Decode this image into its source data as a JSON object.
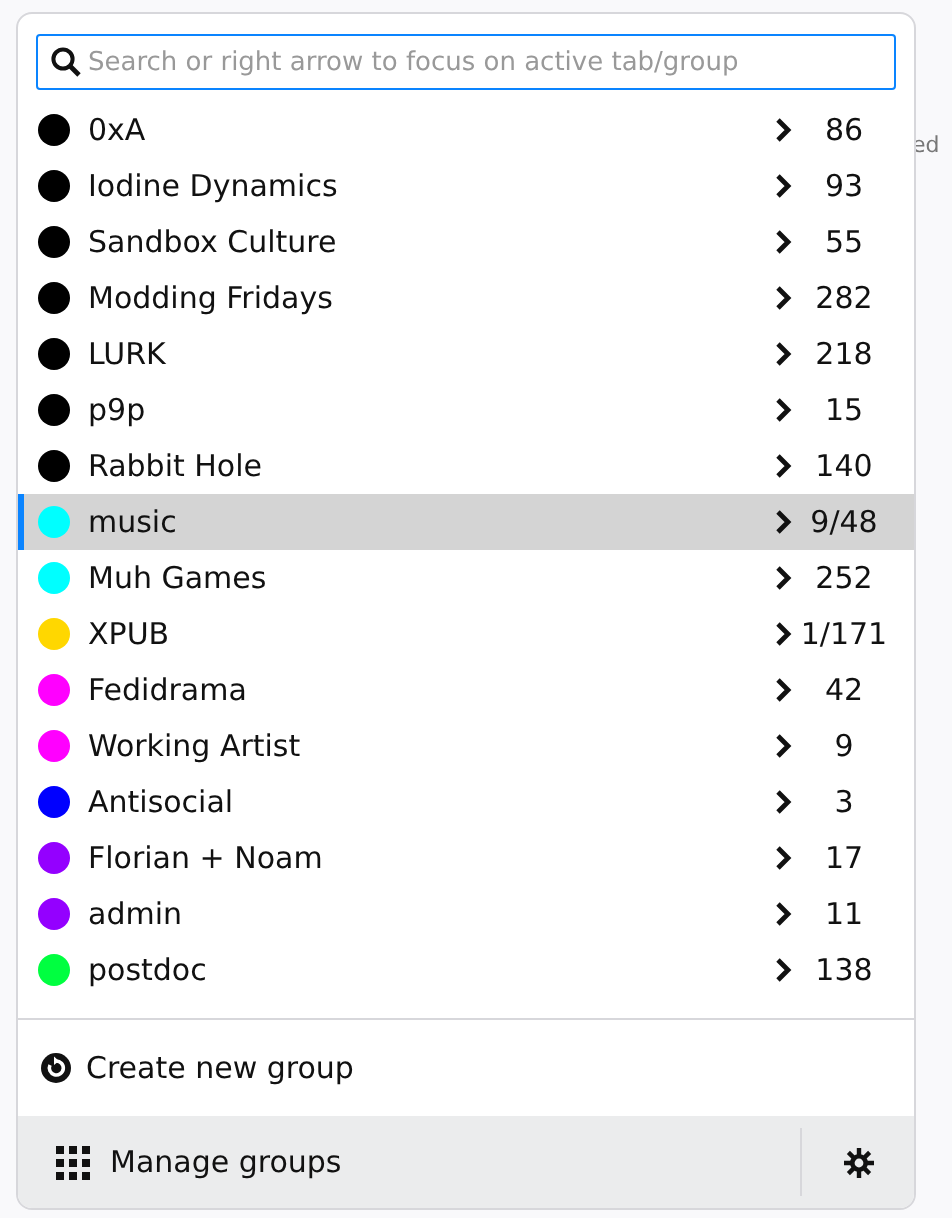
{
  "background": {
    "fragments": [
      {
        "text": "ed"
      }
    ]
  },
  "search": {
    "placeholder": "Search or right arrow to focus on active tab/group"
  },
  "groups": [
    {
      "name": "0xA",
      "color": "#000000",
      "count": "86",
      "selected": false
    },
    {
      "name": "Iodine Dynamics",
      "color": "#000000",
      "count": "93",
      "selected": false
    },
    {
      "name": "Sandbox Culture",
      "color": "#000000",
      "count": "55",
      "selected": false
    },
    {
      "name": "Modding Fridays",
      "color": "#000000",
      "count": "282",
      "selected": false
    },
    {
      "name": "LURK",
      "color": "#000000",
      "count": "218",
      "selected": false
    },
    {
      "name": "p9p",
      "color": "#000000",
      "count": "15",
      "selected": false
    },
    {
      "name": "Rabbit Hole",
      "color": "#000000",
      "count": "140",
      "selected": false
    },
    {
      "name": "music",
      "color": "#00ffff",
      "count": "9/48",
      "selected": true
    },
    {
      "name": "Muh Games",
      "color": "#00ffff",
      "count": "252",
      "selected": false
    },
    {
      "name": "XPUB",
      "color": "#ffd700",
      "count": "1/171",
      "selected": false
    },
    {
      "name": "Fedidrama",
      "color": "#ff00ff",
      "count": "42",
      "selected": false
    },
    {
      "name": "Working Artist",
      "color": "#ff00ff",
      "count": "9",
      "selected": false
    },
    {
      "name": "Antisocial",
      "color": "#0000ff",
      "count": "3",
      "selected": false
    },
    {
      "name": "Florian + Noam",
      "color": "#9400ff",
      "count": "17",
      "selected": false
    },
    {
      "name": "admin",
      "color": "#9400ff",
      "count": "11",
      "selected": false
    },
    {
      "name": "postdoc",
      "color": "#00ff40",
      "count": "138",
      "selected": false
    }
  ],
  "create_group": "Create new group",
  "manage_groups": "Manage groups"
}
